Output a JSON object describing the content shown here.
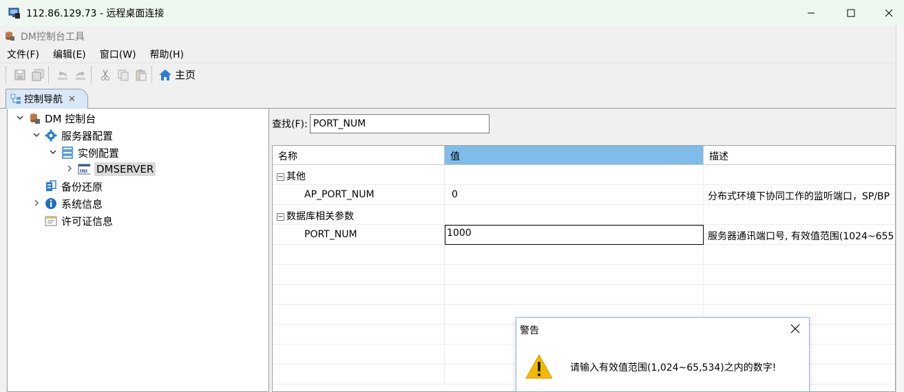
{
  "rd_window": {
    "title": "112.86.129.73 - 远程桌面连接"
  },
  "app": {
    "title": "DM控制台工具"
  },
  "menu": [
    "文件(F)",
    "编辑(E)",
    "窗口(W)",
    "帮助(H)"
  ],
  "toolbar": {
    "home_label": "主页"
  },
  "nav_tab": {
    "label": "控制导航"
  },
  "tree": {
    "root": "DM 控制台",
    "server_config": "服务器配置",
    "instance_config": "实例配置",
    "dmserver": "DMSERVER",
    "backup_restore": "备份还原",
    "system_info": "系统信息",
    "license_info": "许可证信息"
  },
  "find": {
    "label": "查找(F):",
    "value": "PORT_NUM"
  },
  "table": {
    "headers": [
      "名称",
      "值",
      "描述"
    ],
    "group_other": "其他",
    "row_ap_name": "AP_PORT_NUM",
    "row_ap_value": "0",
    "row_ap_desc": "分布式环境下协同工作的监听端口，SP/BP",
    "group_db": "数据库相关参数",
    "row_port_name": "PORT_NUM",
    "row_port_value": "1000",
    "row_port_desc": "服务器通讯端口号, 有效值范围(1024~655"
  },
  "dialog": {
    "title": "警告",
    "message": "请输入有效值范围(1,024~65,534)之内的数字!"
  },
  "colors": {
    "header_active": "#80bce8",
    "tab_bg": "#d9e8f7",
    "warning": "#f5b800"
  }
}
